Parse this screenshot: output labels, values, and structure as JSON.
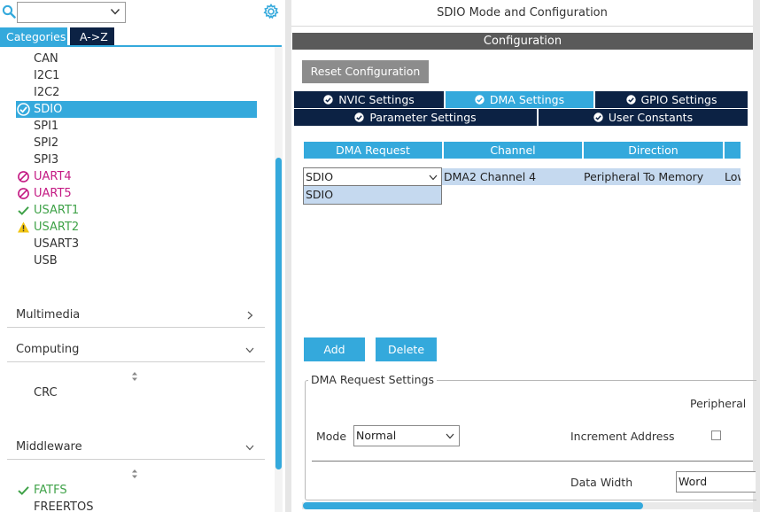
{
  "search": {
    "value": ""
  },
  "left_tabs": {
    "categories": "Categories",
    "az": "A->Z"
  },
  "peripherals": [
    {
      "label": "CAN",
      "status": "none"
    },
    {
      "label": "I2C1",
      "status": "none"
    },
    {
      "label": "I2C2",
      "status": "none"
    },
    {
      "label": "SDIO",
      "status": "configured-selected"
    },
    {
      "label": "SPI1",
      "status": "none"
    },
    {
      "label": "SPI2",
      "status": "none"
    },
    {
      "label": "SPI3",
      "status": "none"
    },
    {
      "label": "UART4",
      "status": "unavailable"
    },
    {
      "label": "UART5",
      "status": "unavailable"
    },
    {
      "label": "USART1",
      "status": "ok"
    },
    {
      "label": "USART2",
      "status": "warning"
    },
    {
      "label": "USART3",
      "status": "none"
    },
    {
      "label": "USB",
      "status": "none"
    }
  ],
  "sections": {
    "multimedia": "Multimedia",
    "computing": "Computing",
    "computing_items": [
      "CRC"
    ],
    "middleware": "Middleware",
    "middleware_items": [
      "FATFS",
      "FREERTOS"
    ]
  },
  "colors": {
    "accent": "#34a9dc",
    "navy": "#0c2244",
    "unavailable": "#c41a83",
    "ok": "#3fa248",
    "warning": "#f2c511"
  },
  "right": {
    "title": "SDIO Mode and Configuration",
    "config_header": "Configuration",
    "reset_button": "Reset Configuration",
    "tabs_row1": [
      "NVIC Settings",
      "DMA Settings",
      "GPIO Settings"
    ],
    "tabs_row2": [
      "Parameter Settings",
      "User Constants"
    ],
    "active_tab": "DMA Settings",
    "table": {
      "headers": [
        "DMA Request",
        "Channel",
        "Direction",
        ""
      ],
      "row": {
        "request": "SDIO",
        "channel": "DMA2 Channel 4",
        "direction": "Peripheral To Memory",
        "priority": "Low"
      },
      "dropdown_options": [
        "SDIO"
      ]
    },
    "add_button": "Add",
    "delete_button": "Delete",
    "request_settings": {
      "title": "DMA Request Settings",
      "peripheral_label": "Peripheral",
      "mode_label": "Mode",
      "mode_value": "Normal",
      "increment_label": "Increment Address",
      "increment_checked": false,
      "data_width_label": "Data Width",
      "data_width_value": "Word"
    }
  }
}
